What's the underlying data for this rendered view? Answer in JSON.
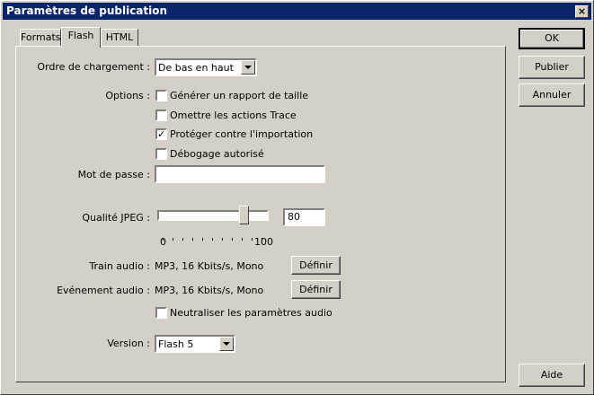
{
  "window": {
    "title": "Paramètres de publication",
    "close_glyph": "×"
  },
  "tabs": [
    {
      "label": "Formats"
    },
    {
      "label": "Flash"
    },
    {
      "label": "HTML"
    }
  ],
  "load_order": {
    "label": "Ordre de chargement :",
    "value": "De bas en haut"
  },
  "options": {
    "label": "Options :",
    "items": [
      {
        "label": "Générer un rapport de taille",
        "checked": false
      },
      {
        "label": "Omettre les actions Trace",
        "checked": false
      },
      {
        "label": "Protéger contre l'importation",
        "checked": true
      },
      {
        "label": "Débogage autorisé",
        "checked": false
      }
    ]
  },
  "password": {
    "label": "Mot de passe :",
    "value": ""
  },
  "jpeg_quality": {
    "label": "Qualité JPEG :",
    "value": "80",
    "level_fraction": 0.8,
    "min_label": "0",
    "max_label": "100"
  },
  "audio_stream": {
    "label": "Train audio :",
    "value": "MP3, 16 Kbits/s, Mono",
    "button": "Définir"
  },
  "audio_event": {
    "label": "Evénement audio :",
    "value": "MP3, 16 Kbits/s, Mono",
    "button": "Définir"
  },
  "override_audio": {
    "label": "Neutraliser les paramètres audio",
    "checked": false
  },
  "version": {
    "label": "Version :",
    "value": "Flash 5"
  },
  "buttons": {
    "ok": "OK",
    "publish": "Publier",
    "cancel": "Annuler",
    "help": "Aide"
  },
  "check_glyph": "✓",
  "colors": {
    "titlebar": "#0a246a",
    "face": "#d4d0c8"
  }
}
